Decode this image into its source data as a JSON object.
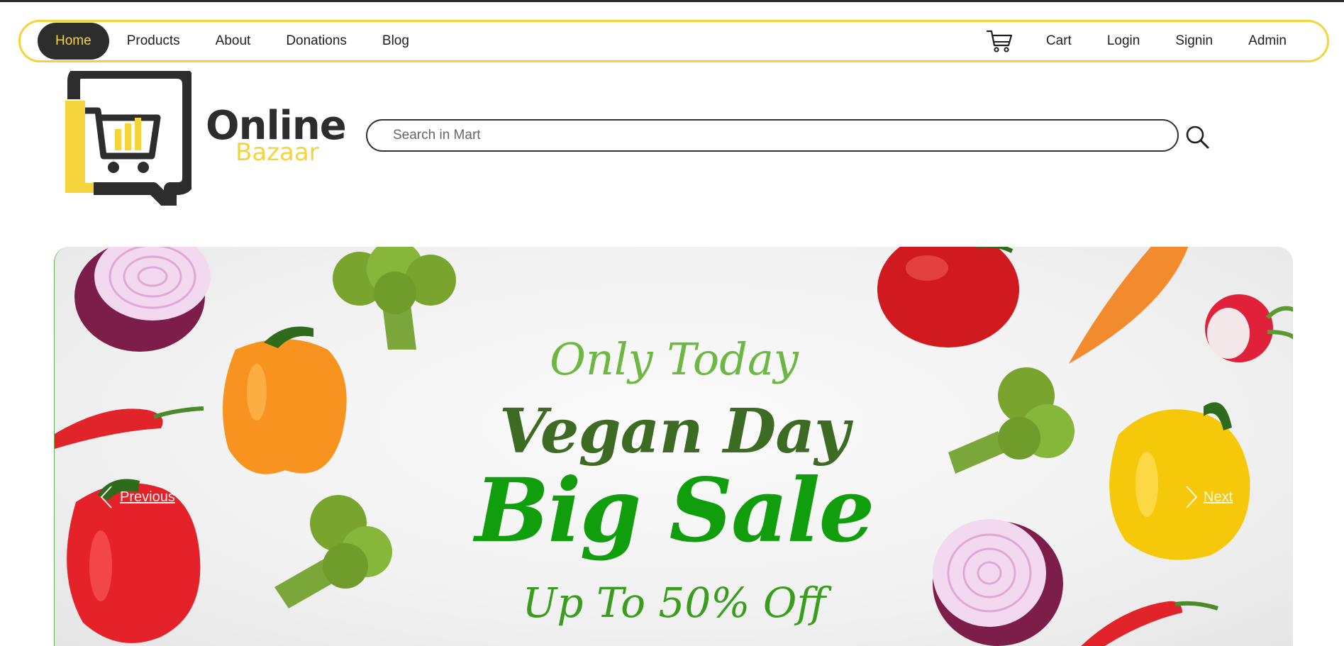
{
  "nav": {
    "left_items": [
      {
        "label": "Home",
        "active": true
      },
      {
        "label": "Products"
      },
      {
        "label": "About"
      },
      {
        "label": "Donations"
      },
      {
        "label": "Blog"
      }
    ],
    "right_items": [
      {
        "label": "Cart"
      },
      {
        "label": "Login"
      },
      {
        "label": "Signin"
      },
      {
        "label": "Admin"
      }
    ],
    "cart_icon": "shopping-cart-icon"
  },
  "brand": {
    "name_primary": "Online",
    "name_secondary": "Bazaar",
    "logo_icon": "shopping-cart-chat-bubble-logo"
  },
  "search": {
    "placeholder": "Search in Mart",
    "value": "",
    "icon": "search-icon"
  },
  "carousel": {
    "line1": "Only Today",
    "line2": "Vegan Day",
    "line3": "Big Sale",
    "line4": "Up To 50% Off",
    "prev_label": "Previous",
    "next_label": "Next"
  },
  "colors": {
    "accent_yellow": "#f5d33a",
    "dark": "#2d2d2d",
    "green_light": "#6cb842",
    "green_dark": "#3d6b23",
    "green_bright": "#119e0d"
  }
}
